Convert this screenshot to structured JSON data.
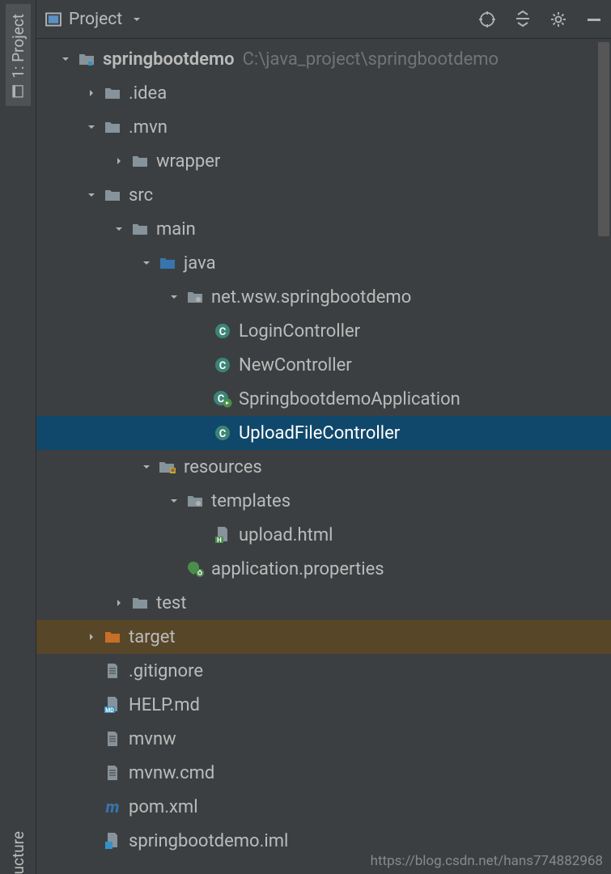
{
  "sidebar": {
    "project_tab": "1: Project",
    "structure_tab": "ucture"
  },
  "toolbar": {
    "title": "Project"
  },
  "tree": {
    "root": {
      "name": "springbootdemo",
      "path": "C:\\java_project\\springbootdemo"
    },
    "idea": ".idea",
    "mvn": ".mvn",
    "wrapper": "wrapper",
    "src": "src",
    "main": "main",
    "java": "java",
    "pkg": "net.wsw.springbootdemo",
    "loginController": "LoginController",
    "newController": "NewController",
    "springbootApp": "SpringbootdemoApplication",
    "uploadController": "UploadFileController",
    "resources": "resources",
    "templates": "templates",
    "uploadHtml": "upload.html",
    "appProps": "application.properties",
    "test": "test",
    "target": "target",
    "gitignore": ".gitignore",
    "helpMd": "HELP.md",
    "mvnw": "mvnw",
    "mvnwCmd": "mvnw.cmd",
    "pomXml": "pom.xml",
    "iml": "springbootdemo.iml"
  },
  "watermark": "https://blog.csdn.net/hans774882968"
}
